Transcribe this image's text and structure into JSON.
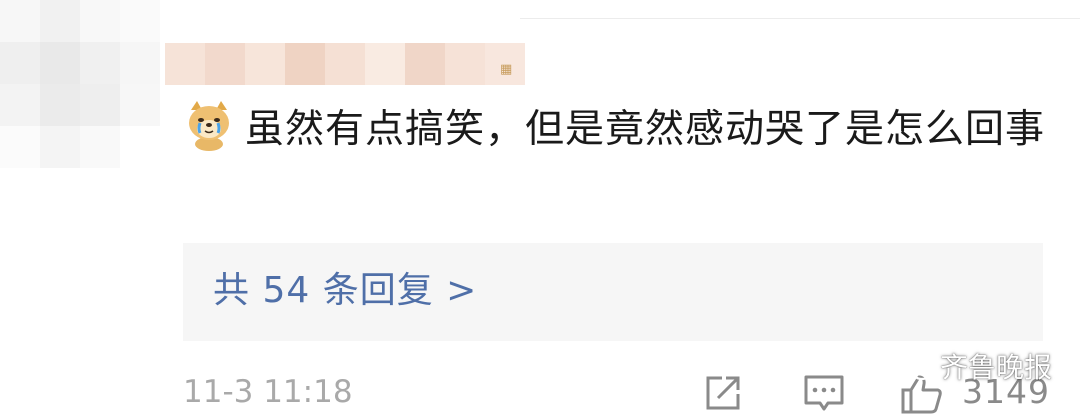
{
  "comment": {
    "emoji": "crying-doge-emoji",
    "text": "虽然有点搞笑，但是竟然感动哭了是怎么回事"
  },
  "replies": {
    "label": "共 54 条回复 >"
  },
  "footer": {
    "timestamp": "11-3 11:18",
    "share_icon": "share-icon",
    "comment_icon": "comment-icon",
    "like_icon": "thumbs-up-icon",
    "like_count": "3149"
  },
  "watermark": {
    "text": "齐鲁晚报",
    "icon": "wechat-icon"
  },
  "colors": {
    "link": "#4f6fa8",
    "text": "#1a1a1a",
    "muted": "#a9a9a9",
    "reply_bg": "#f6f6f6"
  }
}
